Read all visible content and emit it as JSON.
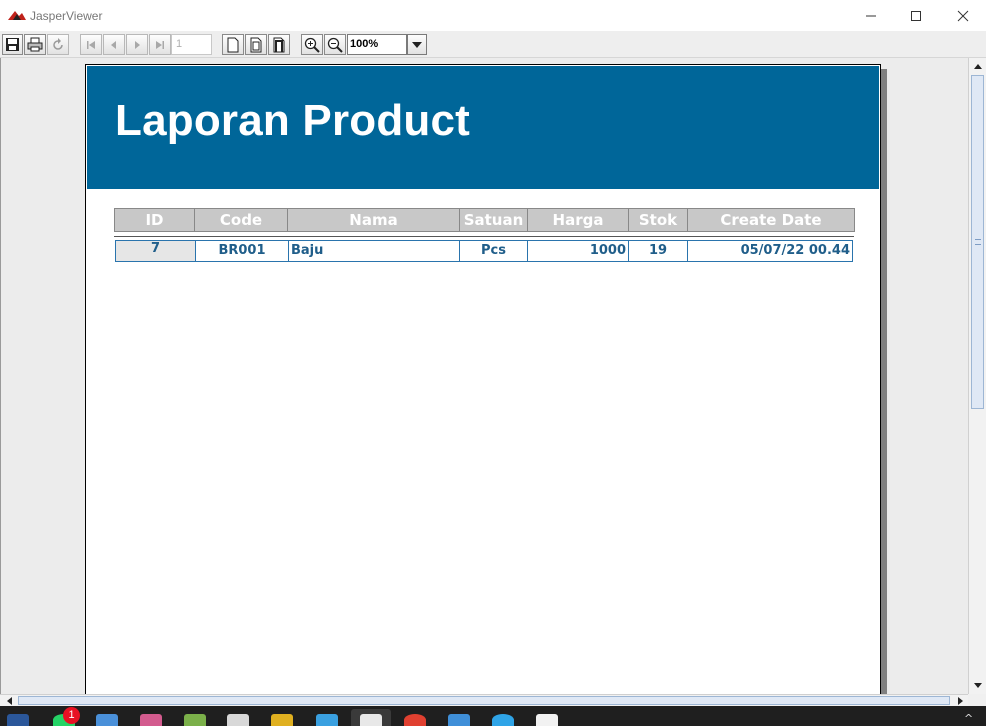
{
  "window": {
    "title": "JasperViewer",
    "controls": {
      "minimize": "—",
      "maximize": "☐",
      "close": "✕"
    }
  },
  "toolbar": {
    "page_number": "1",
    "zoom_value": "100%",
    "buttons": [
      "save-icon",
      "print-icon",
      "reload-icon",
      "first-page-icon",
      "previous-page-icon",
      "next-page-icon",
      "last-page-icon",
      "actual-size-icon",
      "fit-page-icon",
      "fit-width-icon",
      "zoom-in-icon",
      "zoom-out-icon"
    ]
  },
  "report": {
    "title": "Laporan Product",
    "header_color": "#006699",
    "columns": [
      "ID",
      "Code",
      "Nama",
      "Satuan",
      "Harga",
      "Stok",
      "Create Date"
    ],
    "rows": [
      {
        "id": "7",
        "code": "BR001",
        "nama": "Baju",
        "satuan": "Pcs",
        "harga": "1000",
        "stok": "19",
        "create_date": "05/07/22 00.44"
      }
    ]
  },
  "taskbar": {
    "notification_badge": "1",
    "chevron": "^"
  }
}
